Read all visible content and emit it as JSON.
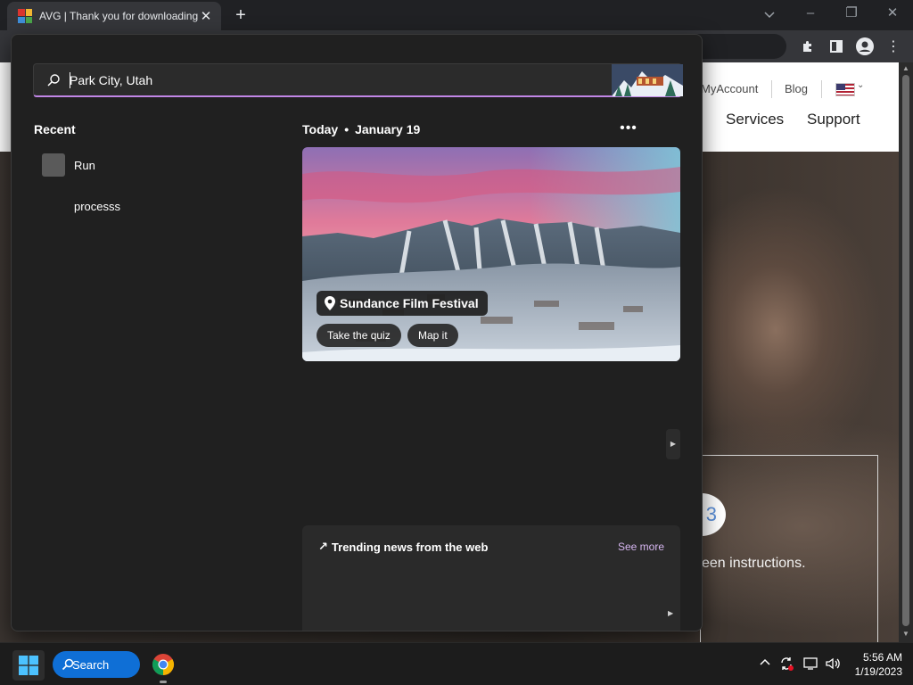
{
  "browser": {
    "tab_title": "AVG | Thank you for downloading",
    "new_tab_icon": "plus-icon",
    "close_tab_icon": "close-icon"
  },
  "website": {
    "header_links": [
      "MyAccount",
      "Blog"
    ],
    "nav": [
      "Services",
      "Support"
    ],
    "step_number": "3",
    "hero_text": "een instructions."
  },
  "search_panel": {
    "query": "Park City, Utah",
    "recent_title": "Recent",
    "recent_items": [
      {
        "label": "Run"
      },
      {
        "label": "processs"
      }
    ],
    "today_label": "Today",
    "date_separator": "•",
    "date": "January 19",
    "more_icon": "more-horizontal-icon",
    "hero": {
      "title": "Sundance Film Festival",
      "buttons": [
        "Take the quiz",
        "Map it"
      ]
    },
    "trending": {
      "title": "Trending news from the web",
      "see_more": "See more"
    }
  },
  "taskbar": {
    "search_label": "Search",
    "time": "5:56 AM",
    "date": "1/19/2023"
  },
  "colors": {
    "accent": "#c186e6",
    "taskbar_search": "#0f6fd6",
    "panel_bg": "#202020"
  }
}
